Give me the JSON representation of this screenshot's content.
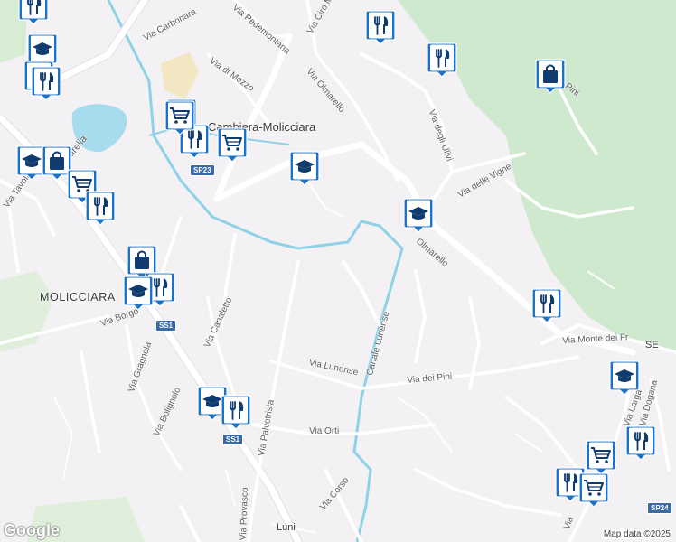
{
  "map": {
    "attribution": "Map data ©2025",
    "logo": "Google",
    "colors": {
      "water": "#a7dbee",
      "canal": "#8ed2e8",
      "park": "#cfe9cf",
      "road": "#ffffff",
      "major_road": "#ffffff",
      "background": "#f3f1f3"
    },
    "places": [
      {
        "id": "molicciara",
        "text": "MOLICCIARA"
      },
      {
        "id": "castelnuovo",
        "text": "Cambiera-Molicciara"
      },
      {
        "id": "luni",
        "text": "Luni"
      },
      {
        "id": "se",
        "text": "SE"
      }
    ],
    "streets": [
      {
        "id": "carbonara",
        "text": "Via Carbonara"
      },
      {
        "id": "pedemontana",
        "text": "Via Pedemontana"
      },
      {
        "id": "ciro",
        "text": "Via Ciro M"
      },
      {
        "id": "di-mezzo",
        "text": "Via di Mezzo"
      },
      {
        "id": "olmarello1",
        "text": "Via Olmarello"
      },
      {
        "id": "olmarello2",
        "text": "Olmarello"
      },
      {
        "id": "ulivi",
        "text": "Via degli Ulivi"
      },
      {
        "id": "vigne",
        "text": "Via delle Vigne"
      },
      {
        "id": "pini1",
        "text": "Pini"
      },
      {
        "id": "aurelia",
        "text": "Via Aurelia"
      },
      {
        "id": "tavolara",
        "text": "Via Tavolara"
      },
      {
        "id": "borgo",
        "text": "Via Borgo"
      },
      {
        "id": "canaletto",
        "text": "Via Canaletto"
      },
      {
        "id": "gragnola",
        "text": "Via Gragnola"
      },
      {
        "id": "bolignolo",
        "text": "Via Bolignolo"
      },
      {
        "id": "palvotrisia",
        "text": "Via Palvotrisia"
      },
      {
        "id": "provasco",
        "text": "Via Provasco"
      },
      {
        "id": "lunense",
        "text": "Via Lunense"
      },
      {
        "id": "canale",
        "text": "Canale Lunense"
      },
      {
        "id": "pini2",
        "text": "Via dei Pini"
      },
      {
        "id": "orti",
        "text": "Via Orti"
      },
      {
        "id": "corso",
        "text": "Via Corso"
      },
      {
        "id": "monte",
        "text": "Via Monte dei Fr"
      },
      {
        "id": "larga",
        "text": "Via Larga"
      },
      {
        "id": "dogana",
        "text": "Via Dogana"
      },
      {
        "id": "ve",
        "text": "Via"
      }
    ],
    "shields": [
      {
        "id": "sp23",
        "text": "SP23"
      },
      {
        "id": "ss1a",
        "text": "SS1"
      },
      {
        "id": "ss1b",
        "text": "SS1"
      },
      {
        "id": "sp24",
        "text": "SP24"
      }
    ],
    "markers": [
      {
        "id": "m1",
        "type": "restaurant-icon"
      },
      {
        "id": "m2",
        "type": "school-icon"
      },
      {
        "id": "m3",
        "type": "restaurant-icon"
      },
      {
        "id": "m4",
        "type": "restaurant-icon"
      },
      {
        "id": "m5",
        "type": "restaurant-icon"
      },
      {
        "id": "m6",
        "type": "restaurant-icon"
      },
      {
        "id": "m7",
        "type": "shopping-cart-icon"
      },
      {
        "id": "m8",
        "type": "restaurant-icon"
      },
      {
        "id": "m9",
        "type": "shopping-cart-icon"
      },
      {
        "id": "m10",
        "type": "school-icon"
      },
      {
        "id": "m11",
        "type": "school-icon"
      },
      {
        "id": "m12",
        "type": "school-icon"
      },
      {
        "id": "m13",
        "type": "shopping-bag-icon"
      },
      {
        "id": "m14",
        "type": "shopping-cart-icon"
      },
      {
        "id": "m15",
        "type": "restaurant-icon"
      },
      {
        "id": "m16",
        "type": "shopping-bag-icon"
      },
      {
        "id": "m17",
        "type": "restaurant-icon"
      },
      {
        "id": "m18",
        "type": "school-icon"
      },
      {
        "id": "m19",
        "type": "restaurant-icon"
      },
      {
        "id": "m20",
        "type": "school-icon"
      },
      {
        "id": "m21",
        "type": "restaurant-icon"
      },
      {
        "id": "m22",
        "type": "shopping-bag-icon"
      },
      {
        "id": "m23",
        "type": "restaurant-icon"
      },
      {
        "id": "m24",
        "type": "school-icon"
      },
      {
        "id": "m25",
        "type": "restaurant-icon"
      },
      {
        "id": "m26",
        "type": "shopping-cart-icon"
      }
    ]
  }
}
